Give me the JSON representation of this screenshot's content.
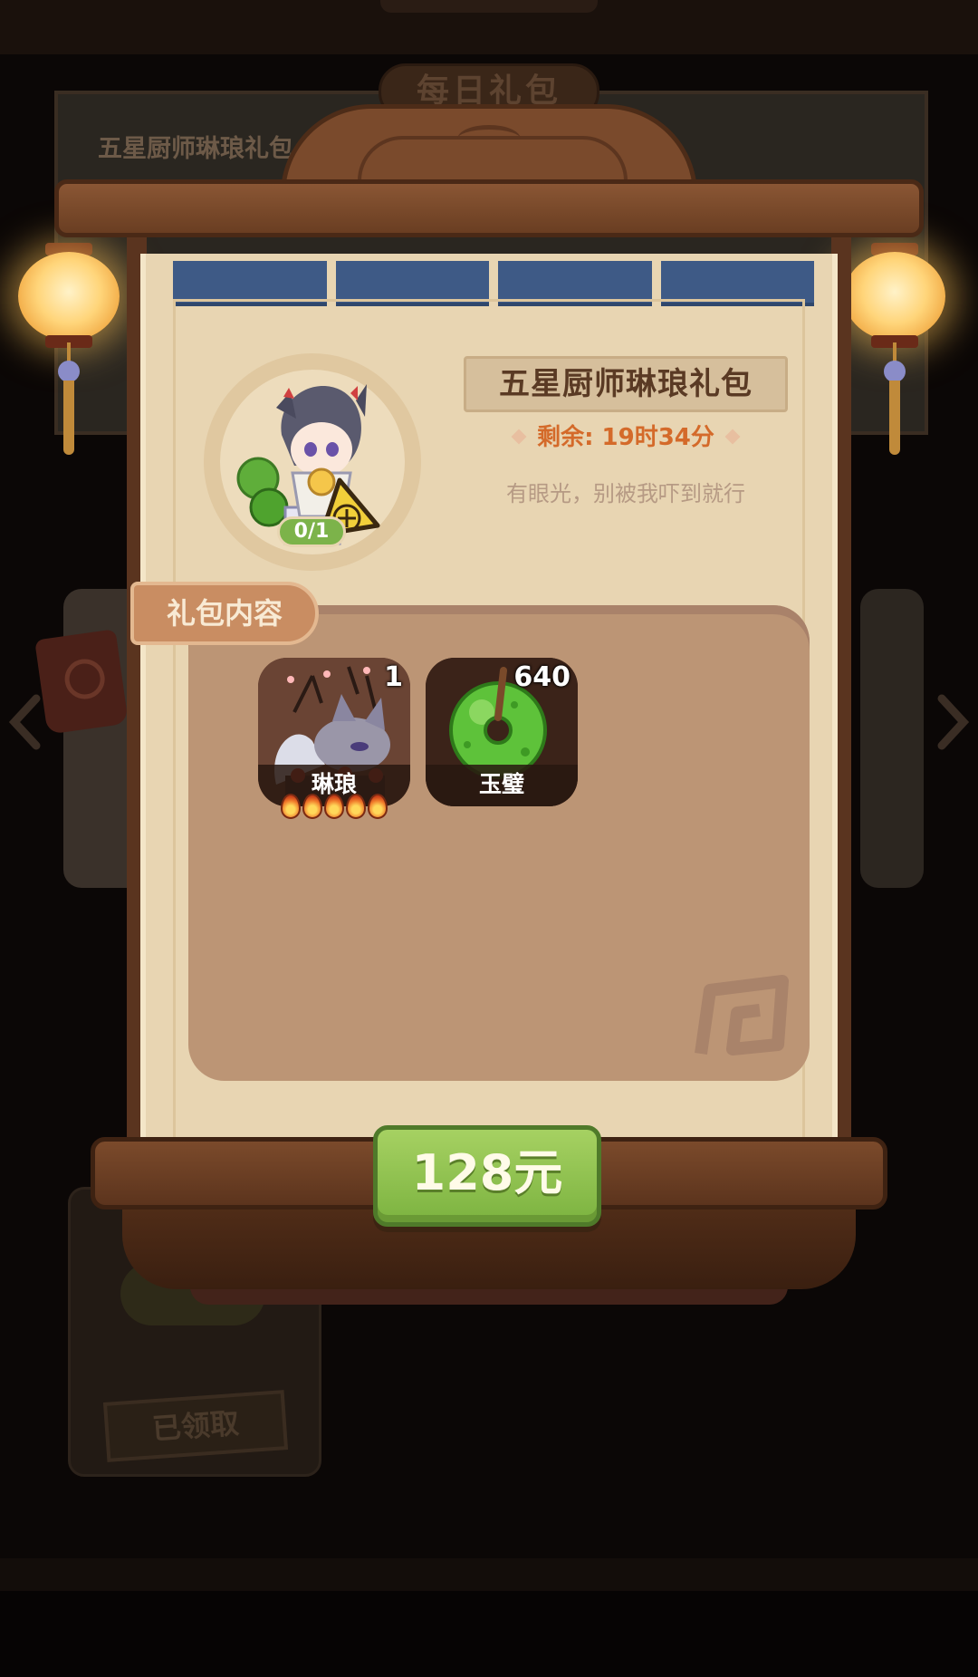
{
  "background": {
    "panel_title": "五星厨师琳琅礼包",
    "header_title": "每日礼包",
    "claimed_button_label": "已领取"
  },
  "pack": {
    "title": "五星厨师琳琅礼包",
    "timer_text": "剩余: 19时34分",
    "description": "有眼光，别被我吓到就行",
    "progress": "0/1"
  },
  "contents": {
    "tab_label": "礼包内容",
    "items": [
      {
        "name": "琳琅",
        "count": "1",
        "stars": 5
      },
      {
        "name": "玉璧",
        "count": "640"
      }
    ]
  },
  "purchase": {
    "price_label": "128元"
  },
  "colors": {
    "accent_green": "#7cb340",
    "timer_orange": "#d46a2a",
    "curtain_blue": "#3e5a86",
    "wood_brown": "#7a4a2c"
  },
  "icons": [
    "lantern-icon",
    "jade-disc-icon",
    "fox-chef-icon",
    "rice-ball-icon",
    "flame-star-icon",
    "chevron-left-icon",
    "chevron-right-icon"
  ]
}
